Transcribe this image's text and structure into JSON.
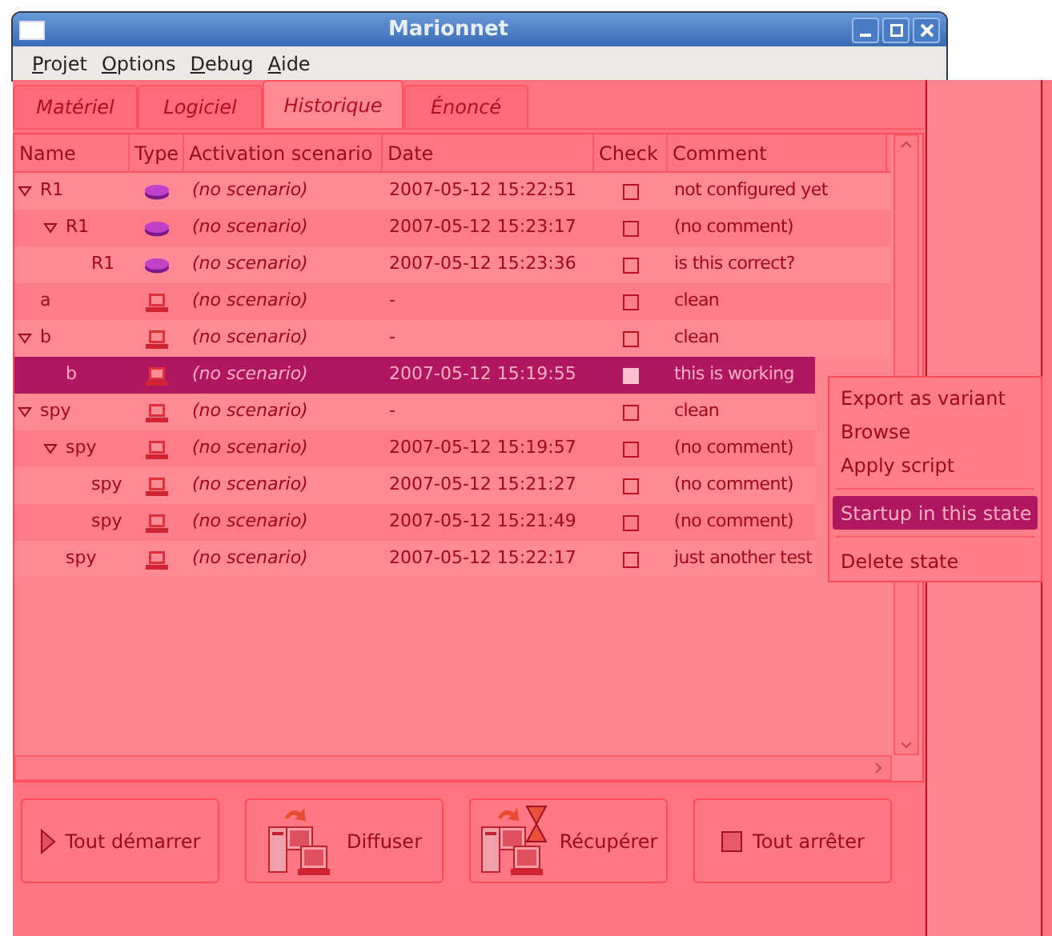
{
  "window": {
    "title": "Marionnet"
  },
  "menu_bar": [
    "Projet",
    "Options",
    "Debug",
    "Aide"
  ],
  "tabs": [
    {
      "label": "Matériel",
      "selected": false
    },
    {
      "label": "Logiciel",
      "selected": false
    },
    {
      "label": "Historique",
      "selected": true
    },
    {
      "label": "Énoncé",
      "selected": false
    }
  ],
  "table": {
    "columns": [
      "Name",
      "Type",
      "Activation scenario",
      "Date",
      "Check",
      "Comment"
    ],
    "rows": [
      {
        "name": "R1",
        "kind": "router",
        "scenario": "(no scenario)",
        "date": "2007-05-12 15:22:51",
        "checked": false,
        "comment": "not configured yet",
        "selected": false,
        "expanded": true,
        "children": [
          {
            "name": "R1",
            "kind": "router",
            "scenario": "(no scenario)",
            "date": "2007-05-12 15:23:17",
            "checked": false,
            "comment": "(no comment)",
            "selected": false,
            "expanded": true,
            "children": [
              {
                "name": "R1",
                "kind": "router",
                "scenario": "(no scenario)",
                "date": "2007-05-12 15:23:36",
                "checked": false,
                "comment": "is this correct?",
                "selected": false
              }
            ]
          }
        ]
      },
      {
        "name": "a",
        "kind": "computer",
        "scenario": "(no scenario)",
        "date": "-",
        "checked": false,
        "comment": "clean",
        "selected": false
      },
      {
        "name": "b",
        "kind": "computer",
        "scenario": "(no scenario)",
        "date": "-",
        "checked": false,
        "comment": "clean",
        "selected": false,
        "expanded": true,
        "children": [
          {
            "name": "b",
            "kind": "computer",
            "scenario": "(no scenario)",
            "date": "2007-05-12 15:19:55",
            "checked": false,
            "comment": "this is working",
            "selected": true
          }
        ]
      },
      {
        "name": "spy",
        "kind": "computer",
        "scenario": "(no scenario)",
        "date": "-",
        "checked": false,
        "comment": "clean",
        "selected": false,
        "expanded": true,
        "children": [
          {
            "name": "spy",
            "kind": "computer",
            "scenario": "(no scenario)",
            "date": "2007-05-12 15:19:57",
            "checked": false,
            "comment": "(no comment)",
            "selected": false,
            "expanded": true,
            "children": [
              {
                "name": "spy",
                "kind": "computer",
                "scenario": "(no scenario)",
                "date": "2007-05-12 15:21:27",
                "checked": false,
                "comment": "(no comment)",
                "selected": false
              },
              {
                "name": "spy",
                "kind": "computer",
                "scenario": "(no scenario)",
                "date": "2007-05-12 15:21:49",
                "checked": false,
                "comment": "(no comment)",
                "selected": false
              }
            ]
          },
          {
            "name": "spy",
            "kind": "computer",
            "scenario": "(no scenario)",
            "date": "2007-05-12 15:22:17",
            "checked": false,
            "comment": "just another test",
            "selected": false
          }
        ]
      }
    ]
  },
  "context_menu": [
    {
      "kind": "item",
      "label": "Export as variant",
      "selected": false
    },
    {
      "kind": "item",
      "label": "Browse",
      "selected": false
    },
    {
      "kind": "item",
      "label": "Apply script",
      "selected": false
    },
    {
      "kind": "separator"
    },
    {
      "kind": "item",
      "label": "Startup in this state",
      "selected": true
    },
    {
      "kind": "separator"
    },
    {
      "kind": "item",
      "label": "Delete state",
      "selected": false
    }
  ],
  "buttons": [
    {
      "kind": "start",
      "label": "Tout démarrer"
    },
    {
      "kind": "broadcast",
      "label": "Diffuser"
    },
    {
      "kind": "retrieve",
      "label": "Récupérer"
    },
    {
      "kind": "stop",
      "label": "Tout arrêter"
    }
  ]
}
